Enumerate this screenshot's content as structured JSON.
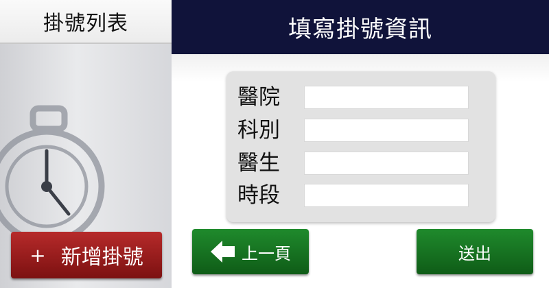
{
  "sidebar": {
    "title": "掛號列表",
    "new_button": {
      "icon": "plus-icon",
      "plus": "+",
      "label": "新增掛號",
      "color": "#9b1c1c"
    },
    "background_icon": "stopwatch-icon"
  },
  "main": {
    "title": "填寫掛號資訊",
    "header_color": "#10133a",
    "form": {
      "fields": [
        {
          "label": "醫院",
          "value": ""
        },
        {
          "label": "科別",
          "value": ""
        },
        {
          "label": "醫生",
          "value": ""
        },
        {
          "label": "時段",
          "value": ""
        }
      ]
    },
    "back_button": {
      "label": "上一頁",
      "icon": "arrow-left-icon"
    },
    "submit_button": {
      "label": "送出"
    },
    "button_color": "#17772a"
  }
}
